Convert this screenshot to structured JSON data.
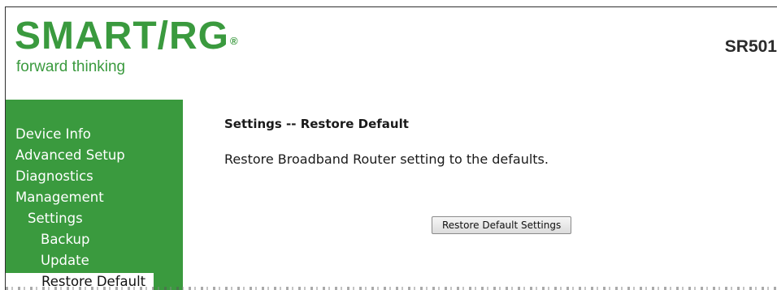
{
  "brand": {
    "logo_text": "SMART/RG",
    "registered_mark": "®",
    "tagline": "forward thinking",
    "model": "SR501"
  },
  "sidebar": {
    "items": [
      {
        "label": "Device Info",
        "level": 0,
        "selected": false
      },
      {
        "label": "Advanced Setup",
        "level": 0,
        "selected": false
      },
      {
        "label": "Diagnostics",
        "level": 0,
        "selected": false
      },
      {
        "label": "Management",
        "level": 0,
        "selected": false
      },
      {
        "label": "Settings",
        "level": 1,
        "selected": false
      },
      {
        "label": "Backup",
        "level": 2,
        "selected": false
      },
      {
        "label": "Update",
        "level": 2,
        "selected": false
      },
      {
        "label": "Restore Default",
        "level": 2,
        "selected": true
      }
    ]
  },
  "main": {
    "title": "Settings -- Restore Default",
    "description": "Restore Broadband Router setting to the defaults.",
    "restore_button_label": "Restore Default Settings"
  },
  "colors": {
    "brand_green": "#3a9a3e",
    "selected_bg": "#ffffff"
  }
}
